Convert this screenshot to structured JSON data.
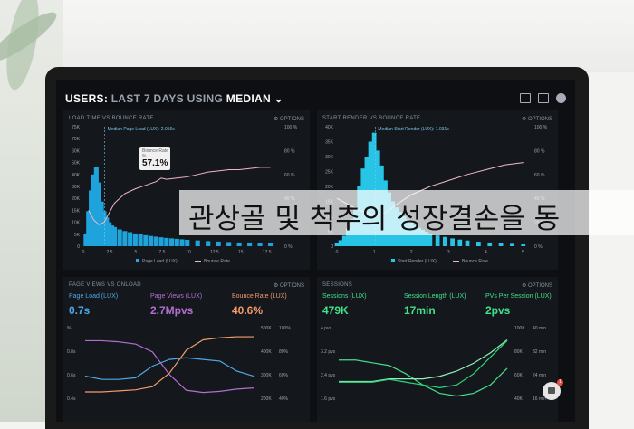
{
  "dashboard": {
    "title_prefix": "USERS:",
    "title_range": "LAST 7 DAYS",
    "title_using": "USING",
    "title_metric": "MEDIAN"
  },
  "panels": {
    "load": {
      "title": "LOAD TIME VS BOUNCE RATE",
      "options": "OPTIONS",
      "median_label": "Median Page Load (LUX): 2.056s",
      "tooltip_title": "Bounce Rate",
      "tooltip_unit": "%",
      "tooltip_value": "57.1%",
      "legend_a": "Page Load (LUX)",
      "legend_b": "Bounce Rate"
    },
    "render": {
      "title": "START RENDER VS BOUNCE RATE",
      "options": "OPTIONS",
      "median_label": "Median Start Render (LUX): 1.031s",
      "legend_a": "Start Render (LUX)",
      "legend_b": "Bounce Rate"
    },
    "pageviews": {
      "title": "PAGE VIEWS VS ONLOAD",
      "options": "OPTIONS",
      "m1_label": "Page Load (LUX)",
      "m1_value": "0.7s",
      "m2_label": "Page Views (LUX)",
      "m2_value": "2.7Mpvs",
      "m3_label": "Bounce Rate (LUX)",
      "m3_value": "40.6%"
    },
    "sessions": {
      "title": "SESSIONS",
      "options": "OPTIONS",
      "m1_label": "Sessions (LUX)",
      "m1_value": "479K",
      "m2_label": "Session Length (LUX)",
      "m2_value": "17min",
      "m3_label": "PVs Per Session (LUX)",
      "m3_value": "2pvs"
    }
  },
  "overlay_text": "관상골 및 척추의 성장결손을 동",
  "chat_badge": "1",
  "colors": {
    "bar_blue": "#1fa3dc",
    "render_cyan": "#27c4e6",
    "bounce_pink": "#f1b6c6",
    "pv_purple": "#b26fd0",
    "bounce_orange": "#f39a6b",
    "session_green": "#42e08a"
  },
  "chart_data": [
    {
      "type": "bar",
      "title": "LOAD TIME VS BOUNCE RATE",
      "x_ticks": [
        "0",
        "2.5",
        "5",
        "7.5",
        "10",
        "12.5",
        "15",
        "17.5"
      ],
      "y_ticks": [
        "0",
        "5K",
        "10K",
        "15K",
        "20K",
        "30K",
        "40K",
        "50K",
        "60K",
        "70K",
        "75K"
      ],
      "y2_ticks": [
        "0 %",
        "20 %",
        "40 %",
        "60 %",
        "80 %",
        "100 %"
      ],
      "ylim": [
        0,
        75000
      ],
      "x": [
        0.25,
        0.5,
        0.75,
        1,
        1.25,
        1.5,
        1.75,
        2,
        2.25,
        2.5,
        2.75,
        3,
        3.5,
        4,
        4.5,
        5,
        5.5,
        6,
        6.5,
        7,
        7.5,
        8,
        8.5,
        9,
        9.5,
        10,
        11,
        12,
        13,
        14,
        15,
        16,
        17,
        18
      ],
      "series": [
        {
          "name": "Page Load (LUX)",
          "values": [
            8000,
            22000,
            35000,
            45000,
            50000,
            40000,
            28000,
            22000,
            18000,
            15000,
            13000,
            12000,
            10500,
            9500,
            8800,
            8000,
            7400,
            6900,
            6400,
            6000,
            5600,
            5200,
            4900,
            4600,
            4300,
            4000,
            3600,
            3200,
            2900,
            2600,
            2300,
            2100,
            1900,
            1700
          ]
        },
        {
          "name": "Bounce Rate",
          "x": [
            0.5,
            1,
            1.5,
            2,
            2.5,
            3,
            4,
            5,
            6,
            7,
            7.5,
            8,
            9,
            10,
            11,
            12,
            13,
            14,
            15,
            16,
            17,
            18
          ],
          "values": [
            30,
            22,
            18,
            20,
            28,
            36,
            44,
            48,
            51,
            54,
            57,
            56,
            57,
            58,
            60,
            62,
            63,
            64,
            64,
            65,
            66,
            66
          ]
        }
      ]
    },
    {
      "type": "bar",
      "title": "START RENDER VS BOUNCE RATE",
      "x_ticks": [
        "0",
        "1",
        "2",
        "3",
        "4",
        "5"
      ],
      "y_ticks": [
        "0",
        "5K",
        "10K",
        "15K",
        "20K",
        "25K",
        "30K",
        "35K",
        "40K"
      ],
      "y2_ticks": [
        "0 %",
        "20 %",
        "40 %",
        "60 %",
        "80 %",
        "100 %"
      ],
      "ylim": [
        0,
        40000
      ],
      "x": [
        0,
        0.1,
        0.2,
        0.3,
        0.4,
        0.5,
        0.6,
        0.7,
        0.8,
        0.9,
        1,
        1.1,
        1.2,
        1.3,
        1.4,
        1.5,
        1.6,
        1.7,
        1.8,
        1.9,
        2,
        2.1,
        2.2,
        2.3,
        2.4,
        2.5,
        2.7,
        2.9,
        3.1,
        3.3,
        3.5,
        3.8,
        4.1,
        4.4,
        4.7,
        5
      ],
      "series": [
        {
          "name": "Start Render (LUX)",
          "values": [
            1000,
            2000,
            3500,
            6000,
            9000,
            13000,
            20000,
            26000,
            30000,
            35000,
            38000,
            32000,
            27000,
            22000,
            18000,
            15000,
            13000,
            11500,
            10000,
            9000,
            8000,
            7000,
            6200,
            5500,
            4800,
            4200,
            3600,
            3100,
            2600,
            2200,
            1900,
            1500,
            1200,
            1000,
            800,
            600
          ]
        },
        {
          "name": "Bounce Rate",
          "x": [
            0,
            0.3,
            0.6,
            1,
            1.3,
            1.6,
            2,
            2.5,
            3,
            3.5,
            4,
            4.5,
            5
          ],
          "values": [
            40,
            35,
            30,
            26,
            28,
            35,
            43,
            50,
            55,
            60,
            64,
            68,
            70
          ]
        }
      ]
    },
    {
      "type": "line",
      "title": "PAGE VIEWS VS ONLOAD",
      "y_ticks": [
        "%",
        "0.8s",
        "0.6s",
        "0.4s"
      ],
      "y2_ticks": [
        "500K",
        "400K",
        "300K",
        "200K"
      ],
      "y3_ticks": [
        "100%",
        "80%",
        "60%",
        "40%"
      ],
      "x": [
        0,
        1,
        2,
        3,
        4,
        5,
        6,
        7,
        8,
        9,
        10
      ],
      "series": [
        {
          "name": "Page Load (LUX)",
          "values": [
            0.62,
            0.6,
            0.6,
            0.61,
            0.68,
            0.72,
            0.73,
            0.72,
            0.71,
            0.65,
            0.62
          ]
        },
        {
          "name": "Page Views (LUX)",
          "values": [
            470,
            470,
            465,
            455,
            420,
            320,
            250,
            240,
            245,
            255,
            260
          ]
        },
        {
          "name": "Bounce Rate (LUX)",
          "values": [
            40,
            40,
            41,
            42,
            45,
            58,
            80,
            90,
            92,
            93,
            93
          ]
        }
      ]
    },
    {
      "type": "line",
      "title": "SESSIONS",
      "y_ticks": [
        "4 pvs",
        "3.2 pvs",
        "2.4 pvs",
        "1.6 pvs"
      ],
      "y2_ticks": [
        "100K",
        "80K",
        "60K",
        "40K"
      ],
      "y3_ticks": [
        "40 min",
        "32 min",
        "24 min",
        "16 min"
      ],
      "x": [
        0,
        1,
        2,
        3,
        4,
        5,
        6,
        7,
        8,
        9,
        10
      ],
      "series": [
        {
          "name": "Sessions (LUX)",
          "values": [
            3.1,
            3.1,
            3.0,
            2.9,
            2.6,
            2.2,
            1.9,
            1.8,
            1.9,
            2.2,
            2.8
          ]
        },
        {
          "name": "Session Length (LUX)",
          "values": [
            22,
            22,
            22,
            23,
            23,
            23,
            24,
            26,
            29,
            33,
            38
          ]
        },
        {
          "name": "PVs Per Session (LUX)",
          "values": [
            2.3,
            2.3,
            2.3,
            2.4,
            2.3,
            2.2,
            2.1,
            2.2,
            2.6,
            3.2,
            3.8
          ]
        }
      ]
    }
  ]
}
